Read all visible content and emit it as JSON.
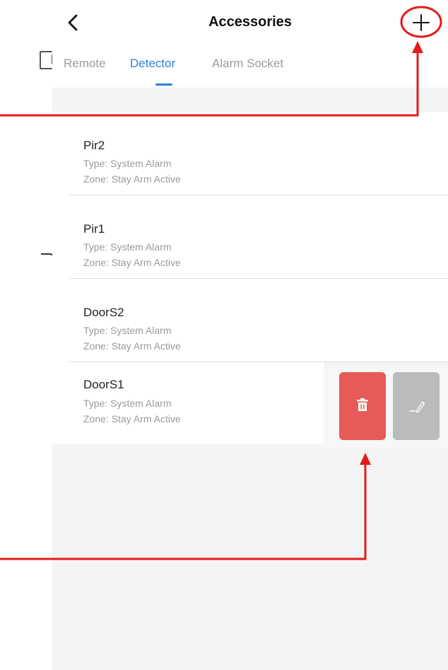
{
  "header": {
    "title": "Accessories",
    "back_icon": "chevron-left-icon",
    "add_icon": "plus-icon"
  },
  "tabs": [
    {
      "label": "Remote",
      "active": false
    },
    {
      "label": "Detector",
      "active": true
    },
    {
      "label": "Alarm Socket",
      "active": false
    }
  ],
  "items": [
    {
      "name": "Pir2",
      "type": "Type: System Alarm",
      "zone": "Zone: Stay Arm Active"
    },
    {
      "name": "Pir1",
      "type": "Type: System Alarm",
      "zone": "Zone: Stay Arm Active"
    },
    {
      "name": "DoorS2",
      "type": "Type: System Alarm",
      "zone": "Zone: Stay Arm Active"
    },
    {
      "name": "DoorS1",
      "type": "Type: System Alarm",
      "zone": "Zone: Stay Arm Active"
    }
  ],
  "swipe_actions": {
    "delete_icon": "trash-icon",
    "edit_icon": "pencil-icon"
  },
  "colors": {
    "accent": "#2f7fe0",
    "delete": "#e65a57",
    "edit": "#b9bbbd",
    "annotation": "#e31b1b"
  }
}
